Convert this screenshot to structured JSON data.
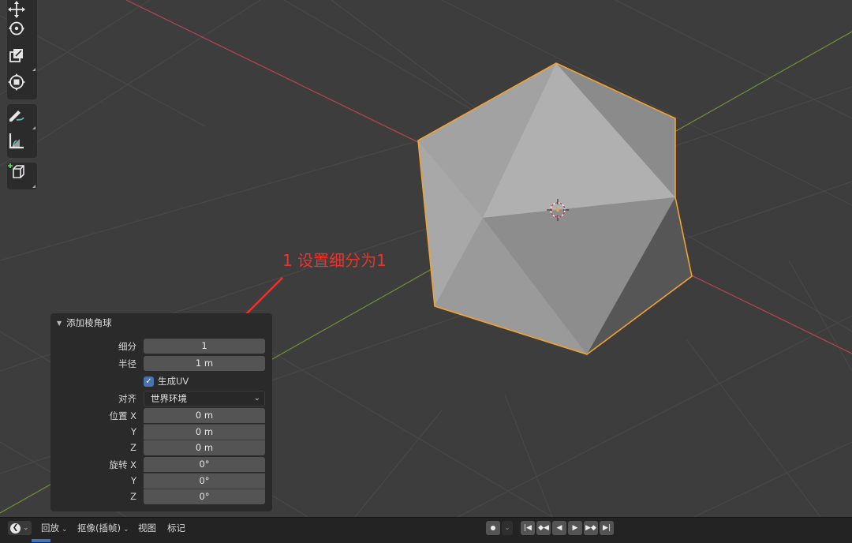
{
  "annotation": {
    "text": "1 设置细分为1",
    "color": "#e8342c"
  },
  "toolbar": {
    "tools": [
      {
        "icon": "move-icon"
      },
      {
        "icon": "rotate-icon"
      },
      {
        "icon": "scale-icon"
      },
      {
        "icon": "transform-icon"
      },
      {
        "icon": "annotate-icon"
      },
      {
        "icon": "measure-icon"
      },
      {
        "icon": "add-cube-icon"
      }
    ]
  },
  "operator_panel": {
    "title": "添加棱角球",
    "subdivisions": {
      "label": "细分",
      "value": "1"
    },
    "radius": {
      "label": "半径",
      "value": "1 m"
    },
    "generate_uv": {
      "label": "生成UV",
      "checked": true
    },
    "align": {
      "label": "对齐",
      "value": "世界环境"
    },
    "location": {
      "label": "位置",
      "x": {
        "axis": "X",
        "value": "0 m"
      },
      "y": {
        "axis": "Y",
        "value": "0 m"
      },
      "z": {
        "axis": "Z",
        "value": "0 m"
      }
    },
    "rotation": {
      "label": "旋转",
      "x": {
        "axis": "X",
        "value": "0°"
      },
      "y": {
        "axis": "Y",
        "value": "0°"
      },
      "z": {
        "axis": "Z",
        "value": "0°"
      }
    }
  },
  "timeline": {
    "playback": "回放",
    "keying": "抠像(插帧)",
    "view": "视图",
    "marker": "标记"
  },
  "colors": {
    "selection_outline": "#f2a233",
    "x_axis": "#b8454f",
    "y_axis": "#6d9137",
    "background": "#3d3d3d"
  }
}
